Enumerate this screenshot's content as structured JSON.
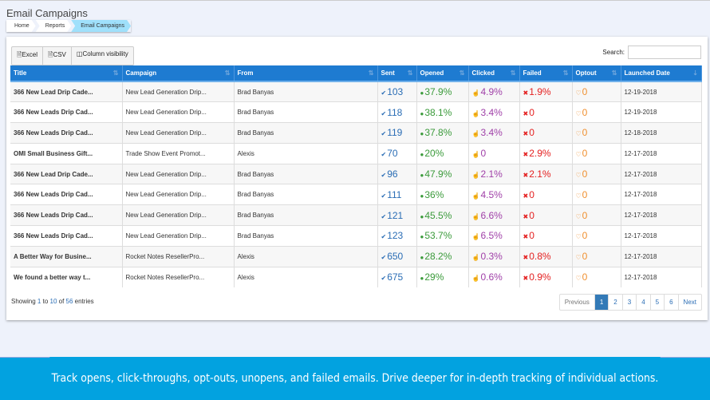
{
  "page_title": "Email Campaigns",
  "breadcrumb": [
    "Home",
    "Reports",
    "Email Campaigns"
  ],
  "toolbar": {
    "excel": "Excel",
    "csv": "CSV",
    "colvis": "Column visibility"
  },
  "search": {
    "label": "Search:",
    "value": ""
  },
  "columns": [
    "Title",
    "Campaign",
    "From",
    "Sent",
    "Opened",
    "Clicked",
    "Failed",
    "Optout",
    "Launched Date"
  ],
  "rows": [
    [
      "366 New Lead Drip Cade...",
      "New Lead Generation Drip...",
      "Brad Banyas",
      "103",
      "37.9%",
      "4.9%",
      "1.9%",
      "0",
      "12-19-2018"
    ],
    [
      "366 New Leads Drip Cad...",
      "New Lead Generation Drip...",
      "Brad Banyas",
      "118",
      "38.1%",
      "3.4%",
      "0",
      "0",
      "12-19-2018"
    ],
    [
      "366 New Leads Drip Cad...",
      "New Lead Generation Drip...",
      "Brad Banyas",
      "119",
      "37.8%",
      "3.4%",
      "0",
      "0",
      "12-18-2018"
    ],
    [
      "OMI Small Business Gift...",
      "Trade Show Event Promot...",
      "Alexis",
      "70",
      "20%",
      "0",
      "2.9%",
      "0",
      "12-17-2018"
    ],
    [
      "366 New Lead Drip Cade...",
      "New Lead Generation Drip...",
      "Brad Banyas",
      "96",
      "47.9%",
      "2.1%",
      "2.1%",
      "0",
      "12-17-2018"
    ],
    [
      "366 New Leads Drip Cad...",
      "New Lead Generation Drip...",
      "Brad Banyas",
      "111",
      "36%",
      "4.5%",
      "0",
      "0",
      "12-17-2018"
    ],
    [
      "366 New Leads Drip Cad...",
      "New Lead Generation Drip...",
      "Brad Banyas",
      "121",
      "45.5%",
      "6.6%",
      "0",
      "0",
      "12-17-2018"
    ],
    [
      "366 New Leads Drip Cad...",
      "New Lead Generation Drip...",
      "Brad Banyas",
      "123",
      "53.7%",
      "6.5%",
      "0",
      "0",
      "12-17-2018"
    ],
    [
      "A Better Way for Busine...",
      "Rocket Notes ResellerPro...",
      "Alexis",
      "650",
      "28.2%",
      "0.3%",
      "0.8%",
      "0",
      "12-17-2018"
    ],
    [
      "We found a better way t...",
      "Rocket Notes ResellerPro...",
      "Alexis",
      "675",
      "29%",
      "0.6%",
      "0.9%",
      "0",
      "12-17-2018"
    ]
  ],
  "footer": {
    "showing": "Showing ",
    "from": "1",
    "to_word": " to ",
    "to": "10",
    "of_word": " of ",
    "total": "56",
    "entries": " entries"
  },
  "pagination": [
    "Previous",
    "1",
    "2",
    "3",
    "4",
    "5",
    "6",
    "Next"
  ],
  "banner": "Track opens, click-throughs, opt-outs, unopens, and failed emails. Drive deeper for in-depth tracking of individual actions."
}
